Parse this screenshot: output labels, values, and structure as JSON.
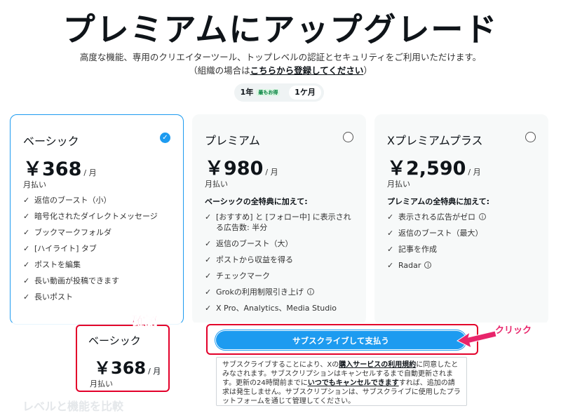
{
  "header": {
    "title": "プレミアムにアップグレード",
    "subtitle": "高度な機能、専用のクリエイターツール、トップレベルの認証とセキュリティをご利用いただけます。",
    "org_prefix": "（組織の場合は",
    "org_link": "こちらから登録してください",
    "org_suffix": "）"
  },
  "billing_toggle": {
    "yearly_label": "1年",
    "yearly_badge": "最もお得",
    "monthly_label": "1ケ月",
    "selected": "monthly"
  },
  "plans": [
    {
      "name": "ベーシック",
      "price": "￥368",
      "unit": "/ 月",
      "billing": "月払い",
      "selected": true,
      "heading": "",
      "features": [
        "返信のブースト（小）",
        "暗号化されたダイレクトメッセージ",
        "ブックマークフォルダ",
        "[ハイライト] タブ",
        "ポストを編集",
        "長い動画が投稿できます",
        "長いポスト"
      ]
    },
    {
      "name": "プレミアム",
      "price": "￥980",
      "unit": "/ 月",
      "billing": "月払い",
      "selected": false,
      "heading": "ベーシックの全特典に加えて:",
      "features": [
        "[おすすめ] と [フォロー中] に表示される広告数: 半分",
        "返信のブースト（大）",
        "ポストから収益を得る",
        "チェックマーク",
        "Grokの利用制限引き上げ",
        "X Pro、Analytics、Media Studio"
      ]
    },
    {
      "name": "Xプレミアムプラス",
      "price": "￥2,590",
      "unit": "/ 月",
      "billing": "月払い",
      "selected": false,
      "heading": "プレミアムの全特典に加えて:",
      "features": [
        "表示される広告がゼロ",
        "返信のブースト（最大）",
        "記事を作成",
        "Radar"
      ]
    }
  ],
  "summary": {
    "name": "ベーシック",
    "price": "￥368",
    "unit": "/ 月",
    "billing": "月払い"
  },
  "subscribe_button": "サブスクライブして支払う",
  "terms": {
    "t1": "サブスクライブすることにより、Xの",
    "link1": "購入サービスの利用規約",
    "t2": "に同意したとみなされます。サブスクリプションはキャンセルするまで自動更新されます。更新の24時間前までに",
    "link2": "いつでもキャンセルできます",
    "t3": "すれば、追加の請求は発生しません。サブスクリプションは、サブスクライブに使用したプラットフォームを通じて管理してください。"
  },
  "compare_heading": "レベルと機能を比較",
  "annotations": {
    "confirm": "確認",
    "click": "クリック",
    "color": "#e8256b"
  },
  "colors": {
    "accent": "#1d9bf0",
    "highlight_border": "#e3002a"
  }
}
